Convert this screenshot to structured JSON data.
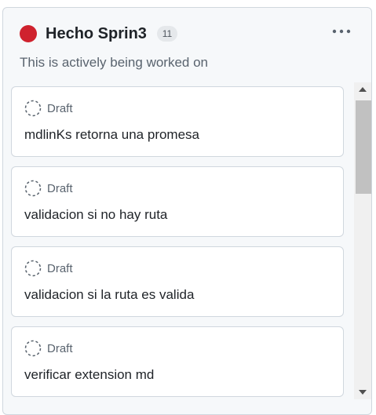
{
  "column": {
    "title": "Hecho Sprin3",
    "count": "11",
    "description": "This is actively being worked on",
    "status_color": "#cf222e",
    "more_icon": "kebab-horizontal-icon"
  },
  "cards": [
    {
      "status": "Draft",
      "title": "mdlinKs retorna una promesa"
    },
    {
      "status": "Draft",
      "title": "validacion si no hay ruta"
    },
    {
      "status": "Draft",
      "title": "validacion si la ruta es valida"
    },
    {
      "status": "Draft",
      "title": "verificar extension md"
    }
  ],
  "scrollbar": {
    "up_icon": "triangle-up-icon",
    "down_icon": "triangle-down-icon"
  }
}
